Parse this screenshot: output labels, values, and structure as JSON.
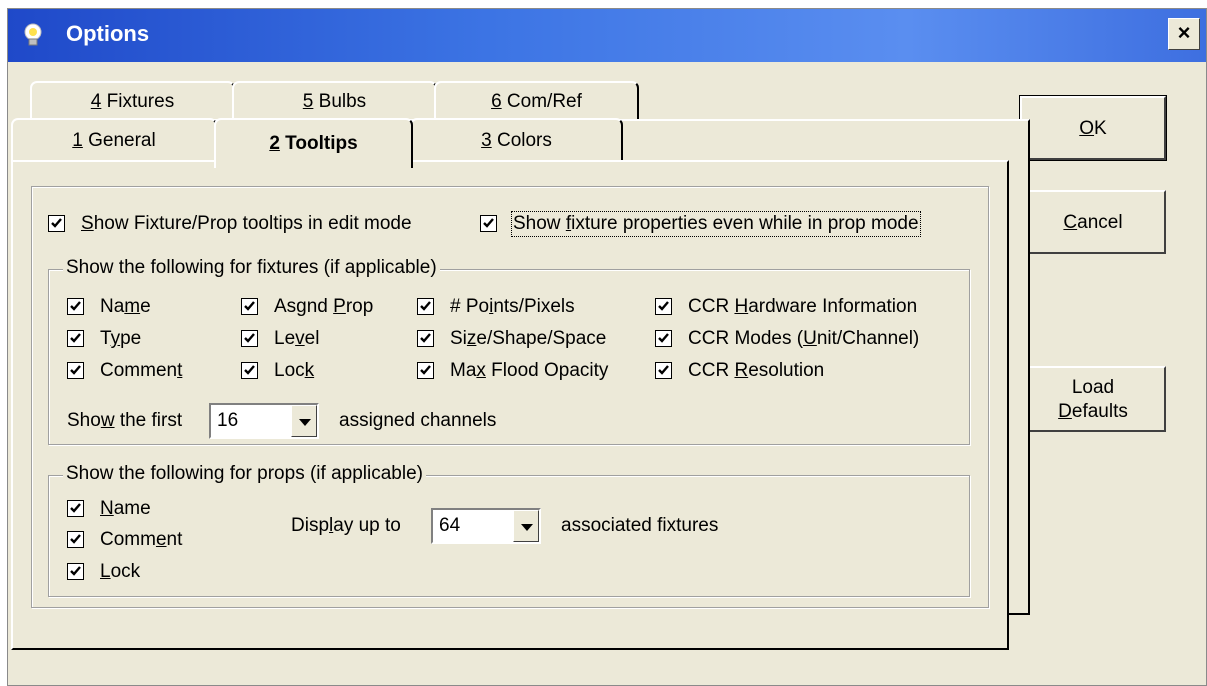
{
  "window": {
    "title": "Options",
    "close_label": "×"
  },
  "tabs": {
    "back_row": [
      {
        "key": "4",
        "rest": " Fixtures"
      },
      {
        "key": "5",
        "rest": " Bulbs"
      },
      {
        "key": "6",
        "rest": " Com/Ref"
      }
    ],
    "front_row": [
      {
        "key": "1",
        "rest": " General"
      },
      {
        "key": "2",
        "rest": " Tooltips",
        "active": true
      },
      {
        "key": "3",
        "rest": " Colors"
      }
    ]
  },
  "edit_options": {
    "show_tooltips": {
      "pre": "",
      "key": "S",
      "post": "how Fixture/Prop tooltips in edit mode",
      "checked": true
    },
    "show_props": {
      "pre": "Show ",
      "key": "f",
      "post": "ixture properties even while in prop mode",
      "checked": true
    }
  },
  "fixtures_group": {
    "title": "Show the following for fixtures (if applicable)",
    "items": [
      {
        "pre": "Na",
        "key": "m",
        "post": "e",
        "checked": true
      },
      {
        "pre": "T",
        "key": "y",
        "post": "pe",
        "checked": true
      },
      {
        "pre": "Commen",
        "key": "t",
        "post": "",
        "checked": true
      },
      {
        "pre": "Asgnd ",
        "key": "P",
        "post": "rop",
        "checked": true
      },
      {
        "pre": "Le",
        "key": "v",
        "post": "el",
        "checked": true
      },
      {
        "pre": "Loc",
        "key": "k",
        "post": "",
        "checked": true
      },
      {
        "pre": "# Po",
        "key": "i",
        "post": "nts/Pixels",
        "checked": true
      },
      {
        "pre": "Si",
        "key": "z",
        "post": "e/Shape/Space",
        "checked": true
      },
      {
        "pre": "Ma",
        "key": "x",
        "post": " Flood Opacity",
        "checked": true
      },
      {
        "pre": "CCR ",
        "key": "H",
        "post": "ardware Information",
        "checked": true
      },
      {
        "pre": "CCR Modes  (",
        "key": "U",
        "post": "nit/Channel)",
        "checked": true
      },
      {
        "pre": "CCR ",
        "key": "R",
        "post": "esolution",
        "checked": true
      }
    ],
    "first_label": {
      "pre": "Sho",
      "key": "w",
      "post": " the first"
    },
    "first_value": "16",
    "after_label": "assigned channels"
  },
  "props_group": {
    "title": "Show the following for props (if applicable)",
    "items": [
      {
        "pre": "",
        "key": "N",
        "post": "ame",
        "checked": true
      },
      {
        "pre": "Comm",
        "key": "e",
        "post": "nt",
        "checked": true
      },
      {
        "pre": "",
        "key": "L",
        "post": "ock",
        "checked": true
      }
    ],
    "display_label": {
      "pre": "Disp",
      "key": "l",
      "post": "ay up to"
    },
    "display_value": "64",
    "after_label": "associated fixtures"
  },
  "buttons": {
    "ok": {
      "pre": "",
      "key": "O",
      "post": "K"
    },
    "cancel": {
      "pre": "",
      "key": "C",
      "post": "ancel"
    },
    "load_line1": "Load",
    "load_line2": {
      "pre": "",
      "key": "D",
      "post": "efaults"
    }
  }
}
